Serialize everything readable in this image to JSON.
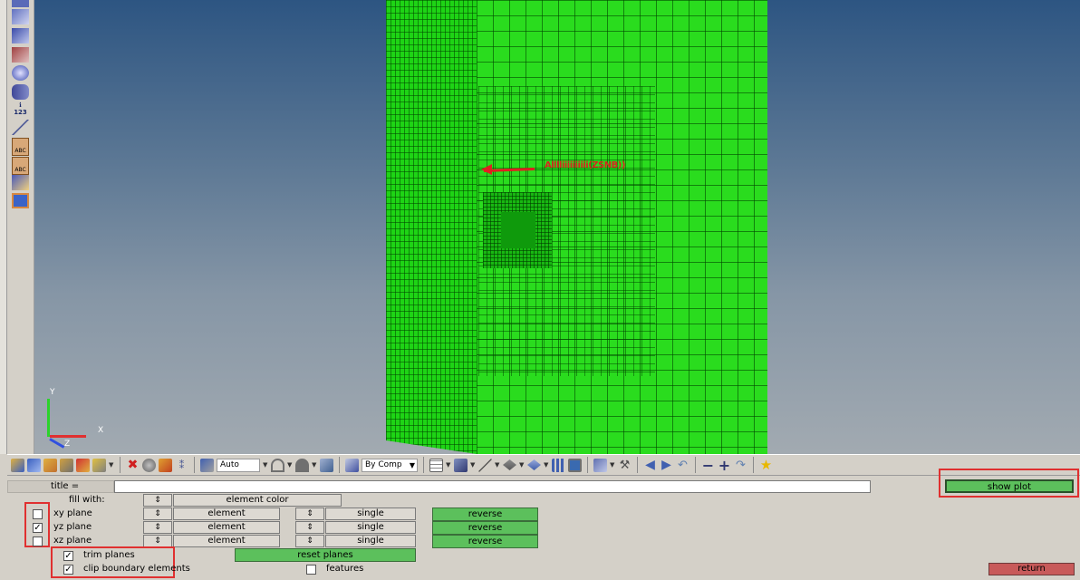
{
  "left_toolbar": {
    "icons": [
      "pointer-icon",
      "mesh-cube-icon",
      "mesh-layers-icon",
      "entity-grid-icon",
      "sphere-icon",
      "binoculars-icon",
      "info-icon",
      "measure-icon",
      "abc-label-icon",
      "abc-label-alt-icon",
      "surface-flip-icon",
      "mesh-panel-icon"
    ],
    "info_text": "123"
  },
  "viewport": {
    "annotation_label": "Alllliiiiiiiiii(ZSNB))",
    "triad": {
      "x": "X",
      "y": "Y",
      "z": "Z"
    }
  },
  "toolbar": {
    "display_mode_value": "Auto",
    "color_mode_value": "By Comp"
  },
  "panel": {
    "title_label": "title =",
    "title_value": "",
    "fill_with_label": "fill with:",
    "fill_with_value": "element color",
    "show_plot_label": "show plot",
    "planes": [
      {
        "label": "xy plane",
        "checked": false,
        "entity": "element",
        "mode": "single",
        "reverse_label": "reverse"
      },
      {
        "label": "yz plane",
        "checked": true,
        "entity": "element",
        "mode": "single",
        "reverse_label": "reverse"
      },
      {
        "label": "xz plane",
        "checked": false,
        "entity": "element",
        "mode": "single",
        "reverse_label": "reverse"
      }
    ],
    "trim_planes_label": "trim planes",
    "trim_planes_checked": true,
    "clip_boundary_label": "clip boundary elements",
    "clip_boundary_checked": true,
    "reset_planes_label": "reset planes",
    "features_label": "features",
    "features_checked": false,
    "return_label": "return",
    "spinner_symbol": "⇕",
    "check_mark": "✓"
  },
  "colors": {
    "mesh_green": "#2adc1e",
    "button_green": "#5cc05c",
    "return_red": "#c85a5a",
    "highlight_red": "#e03030"
  }
}
